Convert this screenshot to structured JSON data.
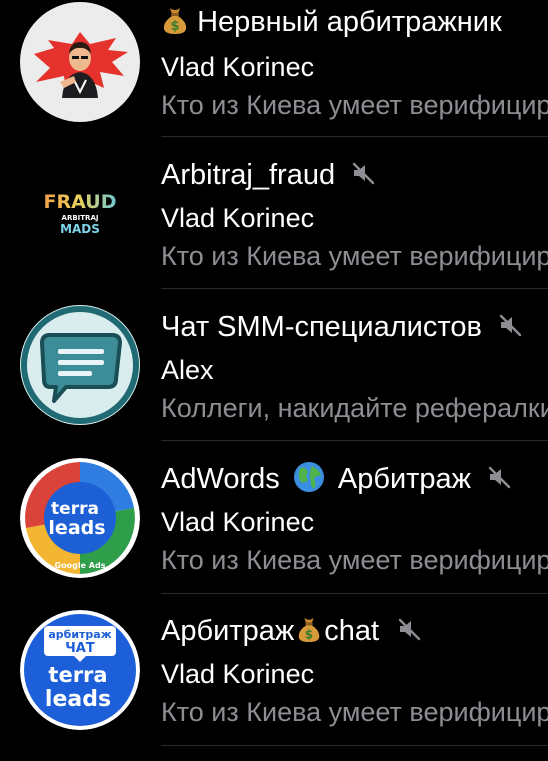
{
  "colors": {
    "background": "#000000",
    "title": "#ffffff",
    "preview": "#8d8d93",
    "separator": "#2a2a2e",
    "muted_icon": "#8d8d93"
  },
  "chats": [
    {
      "title": "Нервный арбитражник",
      "title_prefix_icon": "money-bag-icon",
      "muted": false,
      "sender": "Vlad Korinec",
      "preview": "Кто из Киева умеет верифицировать",
      "avatar": "cartoon-man-red-splash"
    },
    {
      "title": "Arbitraj_fraud",
      "muted": true,
      "sender": "Vlad Korinec",
      "preview": "Кто из Киева умеет верифицировать",
      "avatar": {
        "line1": "FRAUD",
        "line2": "ARBITRAJ",
        "line3": "MADS"
      }
    },
    {
      "title": "Чат SMM-специалистов",
      "muted": true,
      "sender": "Alex",
      "preview": "Коллеги, накидайте рефералки",
      "avatar": "speech-bubble"
    },
    {
      "title_part1": "AdWords",
      "title_globe_icon": "globe-icon",
      "title_part2": "Арбитраж",
      "muted": true,
      "sender": "Vlad Korinec",
      "preview": "Кто из Киева умеет верифицировать",
      "avatar": {
        "line1": "terra",
        "line2": "leads",
        "line3": "Google Ads"
      }
    },
    {
      "title_part1": "Арбитраж",
      "title_moneybag_icon": "money-bag-icon",
      "title_part2": "chat",
      "muted": true,
      "sender": "Vlad Korinec",
      "preview": "Кто из Киева умеет верифицировать",
      "avatar": {
        "line0": "арбитраж",
        "line1": "ЧАТ",
        "line2": "terra",
        "line3": "leads"
      }
    }
  ]
}
